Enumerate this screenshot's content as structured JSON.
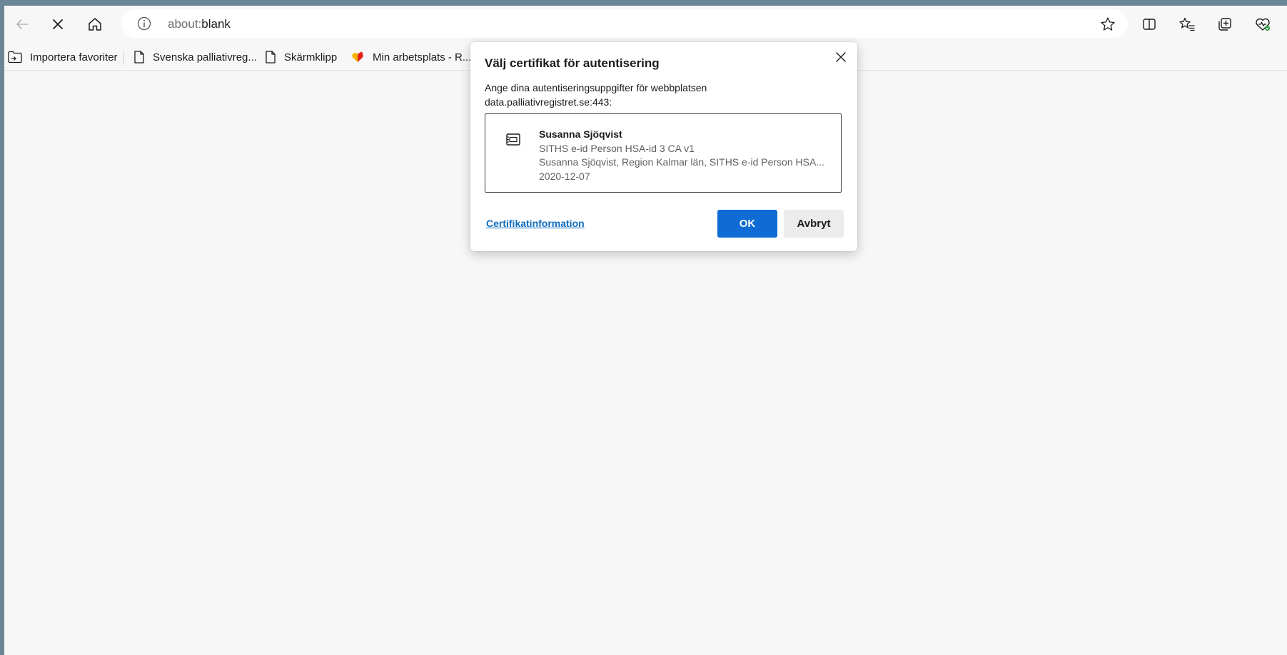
{
  "address_bar": {
    "url_prefix": "about:",
    "url_rest": "blank"
  },
  "icons": {
    "back": "back-arrow-icon",
    "stop": "stop-loading-icon",
    "home": "home-icon",
    "info": "site-info-icon",
    "favorite": "add-favorite-star-icon",
    "split": "split-screen-icon",
    "favorites": "favorites-icon",
    "collections": "collections-icon",
    "health": "browser-essentials-icon"
  },
  "favorites_bar": {
    "items": [
      {
        "label": "Importera favoriter",
        "icon": "import-favorites-icon"
      },
      {
        "label": "Svenska palliativreg...",
        "icon": "page-icon"
      },
      {
        "label": "Skärmklipp",
        "icon": "page-icon"
      },
      {
        "label": "Min arbetsplats - R...",
        "icon": "heart-logo-icon"
      }
    ]
  },
  "dialog": {
    "title": "Välj certifikat för autentisering",
    "description_line1": "Ange dina autentiseringsuppgifter för webbplatsen",
    "description_line2": "data.palliativregistret.se:443:",
    "certificate": {
      "name": "Susanna Sjöqvist",
      "issuer": "SITHS e-id Person HSA-id 3 CA v1",
      "subject": "Susanna Sjöqvist, Region Kalmar län, SITHS e-id Person HSA...",
      "date": "2020-12-07"
    },
    "link_label": "Certifikatinformation",
    "ok_label": "OK",
    "cancel_label": "Avbryt"
  },
  "colors": {
    "accent": "#0f6cd4",
    "link": "#0f6cbd",
    "page_background": "#f7f7f7",
    "window_frame": "#6b8796"
  }
}
